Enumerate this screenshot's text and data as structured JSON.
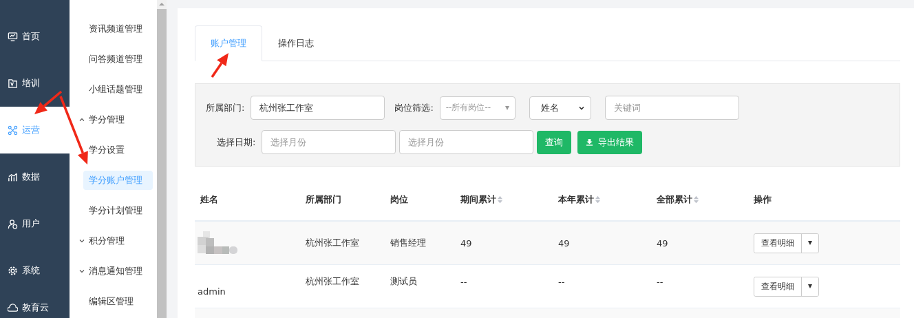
{
  "nav": {
    "items": [
      {
        "label": "首页",
        "selected": false
      },
      {
        "label": "培训",
        "selected": false
      },
      {
        "label": "运营",
        "selected": true
      },
      {
        "label": "数据",
        "selected": false
      },
      {
        "label": "用户",
        "selected": false
      },
      {
        "label": "系统",
        "selected": false
      },
      {
        "label": "教育云",
        "selected": false
      }
    ]
  },
  "submenu": {
    "items": [
      {
        "kind": "item",
        "label": "资讯频道管理",
        "selected": false
      },
      {
        "kind": "item",
        "label": "问答频道管理",
        "selected": false
      },
      {
        "kind": "item",
        "label": "小组话题管理",
        "selected": false
      },
      {
        "kind": "group",
        "label": "学分管理",
        "expanded": true
      },
      {
        "kind": "item",
        "label": "学分设置",
        "selected": false
      },
      {
        "kind": "item",
        "label": "学分账户管理",
        "selected": true
      },
      {
        "kind": "item",
        "label": "学分计划管理",
        "selected": false
      },
      {
        "kind": "group",
        "label": "积分管理",
        "expanded": false
      },
      {
        "kind": "group",
        "label": "消息通知管理",
        "expanded": false
      },
      {
        "kind": "item",
        "label": "编辑区管理",
        "selected": false
      }
    ]
  },
  "tabs": [
    {
      "label": "账户管理",
      "selected": true
    },
    {
      "label": "操作日志",
      "selected": false
    }
  ],
  "filters": {
    "department_label": "所属部门:",
    "department_value": "杭州张工作室",
    "position_label": "岗位筛选:",
    "position_value": "--所有岗位--",
    "field_value": "姓名",
    "keyword_placeholder": "关键词",
    "date_label": "选择日期:",
    "date_from_placeholder": "选择月份",
    "date_to_placeholder": "选择月份",
    "query_button": "查询",
    "export_button": "导出结果"
  },
  "table": {
    "columns": [
      {
        "label": "姓名",
        "sortable": false
      },
      {
        "label": "所属部门",
        "sortable": false
      },
      {
        "label": "岗位",
        "sortable": false
      },
      {
        "label": "期间累计",
        "sortable": true
      },
      {
        "label": "本年累计",
        "sortable": true
      },
      {
        "label": "全部累计",
        "sortable": true
      },
      {
        "label": "操作",
        "sortable": false
      }
    ],
    "rows": [
      {
        "redacted": true,
        "department": "杭州张工作室",
        "position": "销售经理",
        "period": "49",
        "year": "49",
        "total": "49",
        "action": "查看明细"
      },
      {
        "redacted": false,
        "name": "admin",
        "department": "杭州张工作室",
        "position": "测试员",
        "period": "--",
        "year": "--",
        "total": "--",
        "action": "查看明细"
      }
    ]
  }
}
